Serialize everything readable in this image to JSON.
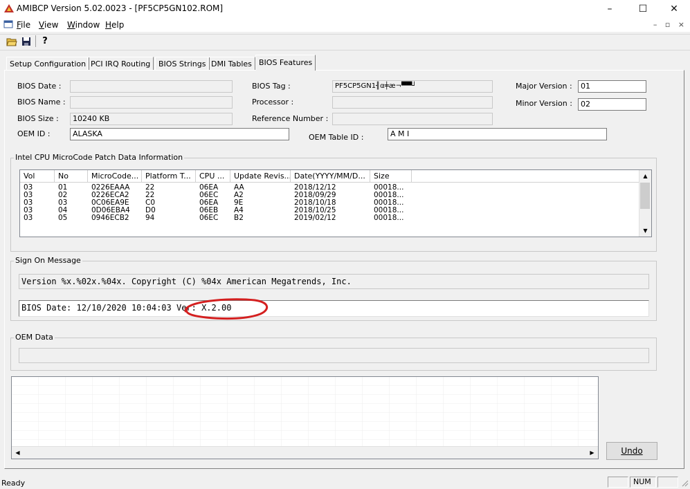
{
  "window": {
    "title": "AMIBCP Version 5.02.0023 - [PF5CP5GN102.ROM]",
    "minimize_glyph": "–",
    "maximize_glyph": "☐",
    "close_glyph": "✕"
  },
  "menu": {
    "items": [
      {
        "underline": "F",
        "rest": "ile"
      },
      {
        "underline": "V",
        "rest": "iew"
      },
      {
        "underline": "W",
        "rest": "indow"
      },
      {
        "underline": "H",
        "rest": "elp"
      }
    ],
    "mdi_controls": "– ▫ ×"
  },
  "toolbar": {
    "icons": [
      "open-folder-icon",
      "save-disk-icon",
      "help-question-icon"
    ],
    "help_glyph": "?"
  },
  "tabs": [
    {
      "label": "Setup Configuration",
      "active": false
    },
    {
      "label": "PCI IRQ Routing",
      "active": false
    },
    {
      "label": "BIOS Strings",
      "active": false
    },
    {
      "label": "DMI Tables",
      "active": false
    },
    {
      "label": "BIOS Features",
      "active": true
    }
  ],
  "bios_info": {
    "bios_date_label": "BIOS Date :",
    "bios_date_value": "",
    "bios_name_label": "BIOS Name :",
    "bios_name_value": "",
    "bios_size_label": "BIOS Size :",
    "bios_size_value": "10240 KB",
    "oem_id_label": "OEM ID :",
    "oem_id_value": "ALASKA",
    "bios_tag_label": "BIOS Tag :",
    "bios_tag_value": "PF5CP5GN1╢α╪æ¬▀▀┘",
    "processor_label": "Processor :",
    "processor_value": "",
    "reference_label": "Reference Number :",
    "reference_value": "",
    "oem_table_id_label": "OEM Table ID :",
    "oem_table_id_value": "A M I",
    "major_version_label": "Major Version :",
    "major_version_value": "01",
    "minor_version_label": "Minor Version :",
    "minor_version_value": "02"
  },
  "microcode": {
    "group_title": "Intel CPU MicroCode Patch Data Information",
    "columns": [
      "Vol",
      "No",
      "MicroCode...",
      "Platform T...",
      "CPU ...",
      "Update Revis...",
      "Date(YYYY/MM/D...",
      "Size"
    ],
    "rows": [
      [
        "03",
        "01",
        "0226EAAA",
        "22",
        "06EA",
        "AA",
        "2018/12/12",
        "00018..."
      ],
      [
        "03",
        "02",
        "0226ECA2",
        "22",
        "06EC",
        "A2",
        "2018/09/29",
        "00018..."
      ],
      [
        "03",
        "03",
        "0C06EA9E",
        "C0",
        "06EA",
        "9E",
        "2018/10/18",
        "00018..."
      ],
      [
        "03",
        "04",
        "0D06EBA4",
        "D0",
        "06EB",
        "A4",
        "2018/10/25",
        "00018..."
      ],
      [
        "03",
        "05",
        "0946ECB2",
        "94",
        "06EC",
        "B2",
        "2019/02/12",
        "00018..."
      ]
    ]
  },
  "sign_on": {
    "group_title": "Sign On Message",
    "line1": "Version %x.%02x.%04x. Copyright (C) %04x American Megatrends, Inc.",
    "line2": "BIOS Date: 12/10/2020 10:04:03 Ver: X.2.00",
    "annotation_color": "#d42020"
  },
  "oem_data": {
    "group_title": "OEM Data",
    "value": ""
  },
  "buttons": {
    "undo_label": "Undo"
  },
  "status": {
    "text": "Ready",
    "num": "NUM"
  }
}
